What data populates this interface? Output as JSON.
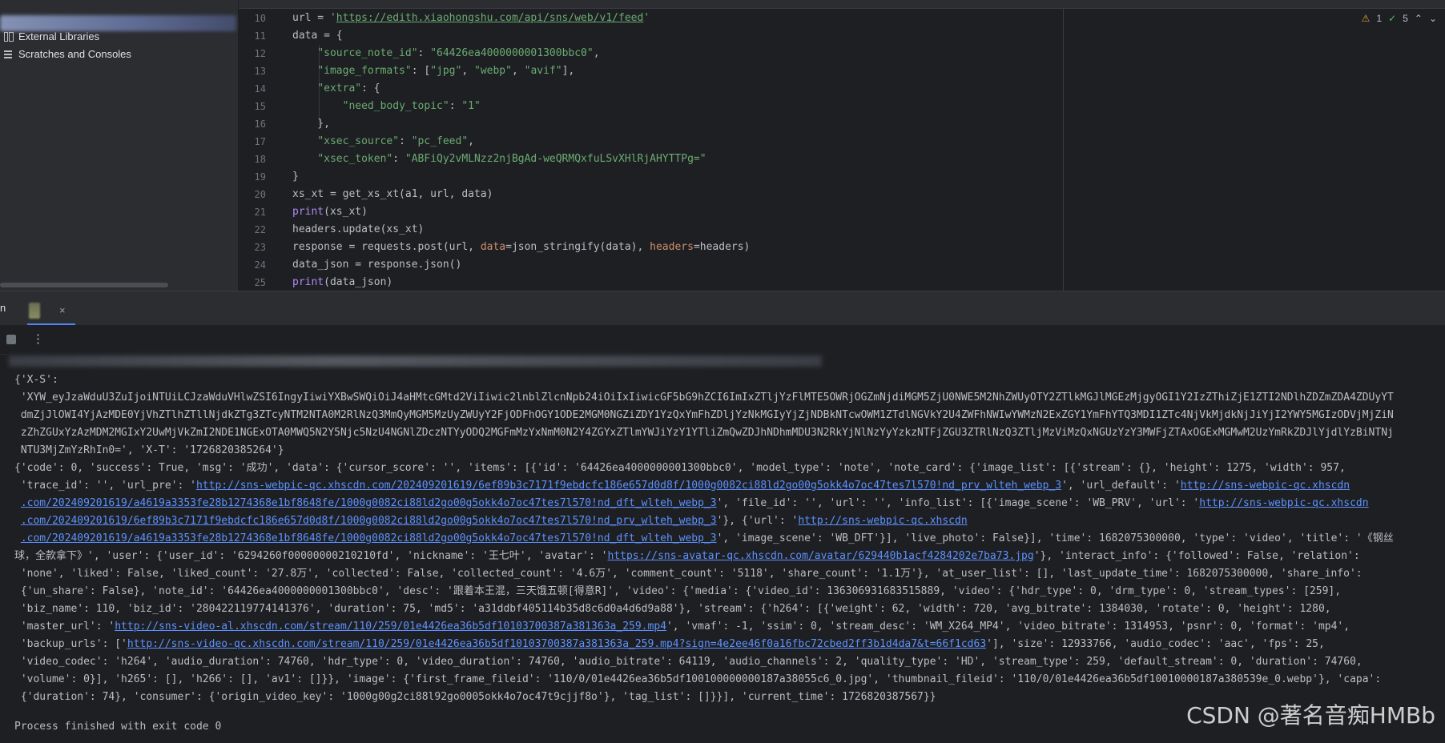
{
  "project": {
    "items": [
      {
        "label": "External Libraries",
        "icon": "library-icon"
      },
      {
        "label": "Scratches and Consoles",
        "icon": "scratches-icon"
      }
    ]
  },
  "editor": {
    "line_numbers": [
      "10",
      "11",
      "12",
      "13",
      "14",
      "15",
      "16",
      "17",
      "18",
      "19",
      "20",
      "21",
      "22",
      "23",
      "24",
      "25"
    ],
    "inspections": {
      "warnings": "1",
      "ok": "5"
    }
  },
  "run": {
    "tab_label": "n",
    "close": "×"
  },
  "console": {
    "exit_text": "Process finished with exit code 0"
  },
  "watermark": "CSDN @著名音痴HMBb"
}
